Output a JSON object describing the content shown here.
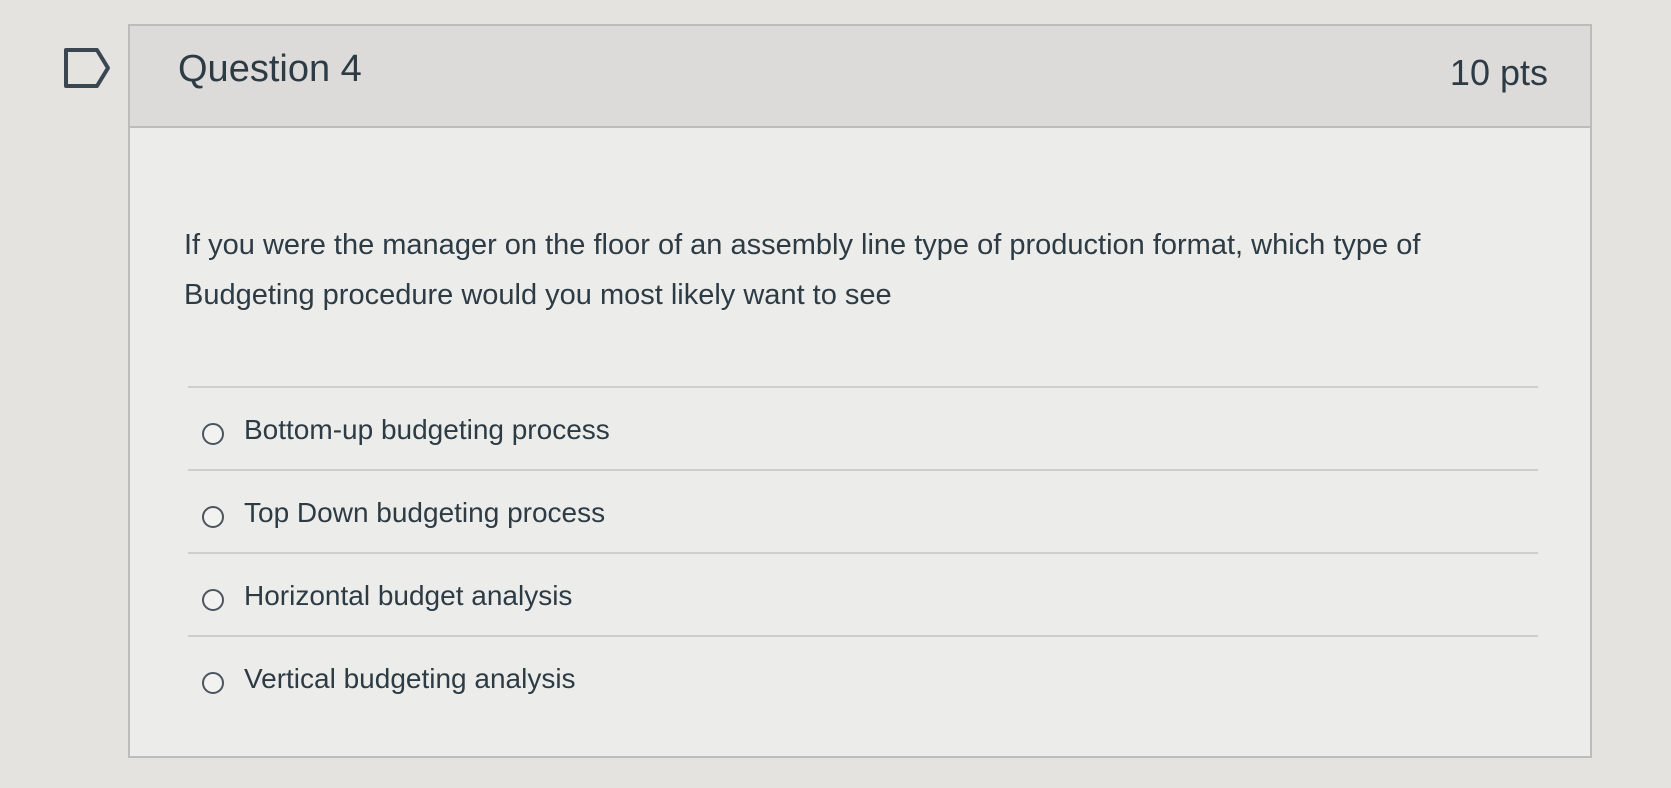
{
  "question": {
    "title": "Question 4",
    "points": "10 pts",
    "text": "If you were the manager on the floor of an assembly line type of production format, which type of Budgeting procedure would you most likely want to see"
  },
  "answers": [
    {
      "label": "Bottom-up budgeting process",
      "selected": false
    },
    {
      "label": "Top Down budgeting process",
      "selected": false
    },
    {
      "label": "Horizontal budget analysis",
      "selected": false
    },
    {
      "label": "Vertical budgeting analysis",
      "selected": false
    }
  ],
  "icons": {
    "flag": "flag-bookmark-icon"
  },
  "colors": {
    "text": "#2d3b45",
    "header_bg": "#dcdbd9",
    "border": "#bcbcba"
  }
}
